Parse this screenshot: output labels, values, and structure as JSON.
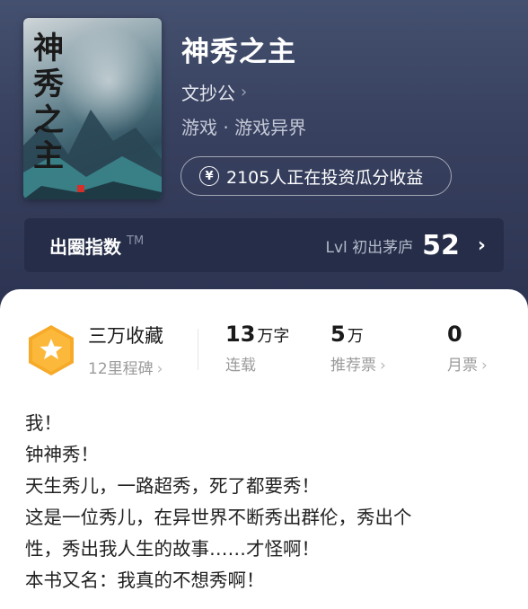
{
  "book": {
    "cover_title": "神秀之主",
    "title": "神秀之主",
    "author": "文抄公",
    "genre": "游戏 · 游戏异界",
    "invest_text": "2105人正在投资瓜分收益",
    "invest_icon": "yen-coin-icon"
  },
  "index_bar": {
    "label": "出圈指数",
    "tm": "TM",
    "level": "Lvl 初出茅庐",
    "score": "52"
  },
  "stats": {
    "favorites": "三万收藏",
    "milestone": "12里程碑",
    "words_num": "13",
    "words_unit": "万字",
    "words_status": "连载",
    "rec_num": "5",
    "rec_unit": "万",
    "rec_label": "推荐票",
    "monthly_num": "0",
    "monthly_label": "月票"
  },
  "description": [
    "我！",
    "钟神秀！",
    "天生秀儿，一路超秀，死了都要秀！",
    "这是一位秀儿，在异世界不断秀出群伦，秀出个",
    "性，秀出我人生的故事……才怪啊！",
    "本书又名：我真的不想秀啊！"
  ],
  "colors": {
    "header": "#3a4360",
    "badge": "#f7a928"
  }
}
